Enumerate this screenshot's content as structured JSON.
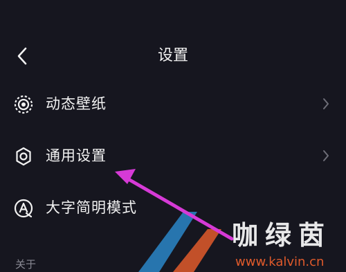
{
  "header": {
    "title": "设置"
  },
  "settings": {
    "items": [
      {
        "label": "动态壁纸",
        "icon": "live-wallpaper-icon"
      },
      {
        "label": "通用设置",
        "icon": "gear-icon"
      },
      {
        "label": "大字简明模式",
        "icon": "large-font-mode-icon"
      }
    ],
    "section_about": "关于"
  },
  "annotation": {
    "arrow_color": "#d63ad6"
  },
  "watermark": {
    "title": "咖绿茵",
    "url": "www.kalvin.cn"
  },
  "colors": {
    "background": "#16161f",
    "text": "#f2f2f2",
    "muted": "#8a8a94",
    "arrow": "#d63ad6"
  }
}
